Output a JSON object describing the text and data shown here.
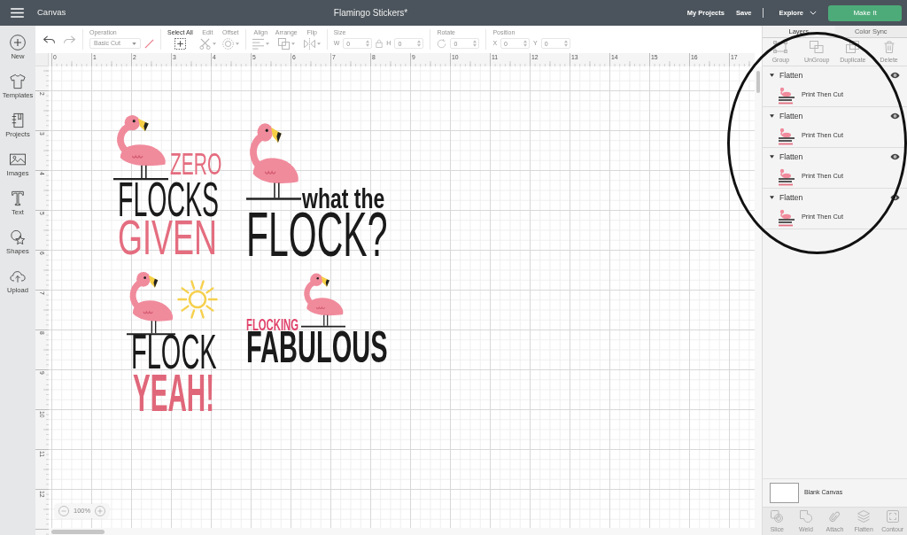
{
  "top_bar": {
    "app_title": "Canvas",
    "project_title": "Flamingo Stickers*",
    "links": [
      "My Projects",
      "Save"
    ],
    "explore": "Explore",
    "make_it": "Make It"
  },
  "sidebar": {
    "items": [
      {
        "label": "New"
      },
      {
        "label": "Templates"
      },
      {
        "label": "Projects"
      },
      {
        "label": "Images"
      },
      {
        "label": "Text"
      },
      {
        "label": "Shapes"
      },
      {
        "label": "Upload"
      }
    ]
  },
  "toolbar": {
    "groups": [
      [
        {
          "kind": "icon_button",
          "disabled": false
        },
        {
          "kind": "icon_button",
          "disabled": true
        }
      ],
      [
        {
          "kind": "dropdown",
          "label": "Operation",
          "value": "Basic Cut",
          "disabled": true
        }
      ],
      [
        {
          "kind": "tool",
          "label": "Select All",
          "disabled": false,
          "menu": false
        },
        {
          "kind": "tool",
          "label": "Edit",
          "disabled": true,
          "menu": true
        },
        {
          "kind": "tool",
          "label": "Offset",
          "disabled": true,
          "menu": true
        }
      ],
      [
        {
          "kind": "tool",
          "label": "Align",
          "disabled": true,
          "menu": true
        },
        {
          "kind": "tool",
          "label": "Arrange",
          "disabled": true,
          "menu": true
        },
        {
          "kind": "tool",
          "label": "Flip",
          "disabled": true,
          "menu": true
        }
      ],
      [
        {
          "kind": "size",
          "label": "Size",
          "disabled": true,
          "fields": [
            {
              "label": "W",
              "value": "0"
            },
            {
              "label": "H",
              "value": "0"
            }
          ]
        }
      ],
      [
        {
          "kind": "rotate",
          "label": "Rotate",
          "disabled": true,
          "fields": [
            {
              "value": "0"
            }
          ]
        }
      ],
      [
        {
          "kind": "position",
          "label": "Position",
          "disabled": true,
          "fields": [
            {
              "label": "X",
              "value": "0"
            },
            {
              "label": "Y",
              "value": "0"
            }
          ]
        }
      ]
    ]
  },
  "rulers": {
    "horizontal": [
      "0",
      "1",
      "2",
      "3",
      "4",
      "5",
      "6",
      "7",
      "8",
      "9",
      "10",
      "11",
      "12",
      "13",
      "14",
      "15",
      "16",
      "17"
    ],
    "vertical": [
      "2",
      "3",
      "4",
      "5",
      "6",
      "7",
      "8",
      "9",
      "10",
      "11",
      "12"
    ]
  },
  "canvas": {
    "designs": [
      {
        "lines": [
          {
            "text": "ZERO",
            "color": "#e46d7f"
          },
          {
            "text": "FLOCKS",
            "color": "#1a1a1a"
          },
          {
            "text": "GIVEN",
            "color": "#e46d7f"
          }
        ]
      },
      {
        "lines": [
          {
            "text": "what the",
            "color": "#1a1a1a"
          },
          {
            "text": "FLOCK?",
            "color": "#1a1a1a"
          }
        ]
      },
      {
        "lines": [
          {
            "text": "FLOCK",
            "color": "#1a1a1a"
          },
          {
            "text": "YEAH!",
            "color": "#e0677a"
          }
        ]
      },
      {
        "lines": [
          {
            "text": "FLOCKING",
            "color": "#e0436b"
          },
          {
            "text": "FABULOUS",
            "color": "#1a1a1a"
          }
        ]
      }
    ],
    "zoom": "100%"
  },
  "layers_panel": {
    "tabs": [
      {
        "label": "Layers",
        "selected": true
      },
      {
        "label": "Color Sync",
        "selected": false
      }
    ],
    "actions": [
      {
        "label": "Group",
        "disabled": true
      },
      {
        "label": "UnGroup",
        "disabled": true
      },
      {
        "label": "Duplicate",
        "disabled": true
      },
      {
        "label": "Delete",
        "disabled": true
      }
    ],
    "layers": [
      {
        "name": "Flatten",
        "expanded": true,
        "visible": true,
        "children": [
          {
            "name": "Print Then Cut"
          }
        ]
      },
      {
        "name": "Flatten",
        "expanded": true,
        "visible": true,
        "children": [
          {
            "name": "Print Then Cut"
          }
        ]
      },
      {
        "name": "Flatten",
        "expanded": true,
        "visible": true,
        "children": [
          {
            "name": "Print Then Cut"
          }
        ]
      },
      {
        "name": "Flatten",
        "expanded": true,
        "visible": true,
        "children": [
          {
            "name": "Print Then Cut"
          }
        ]
      }
    ],
    "canvas_row": "Blank Canvas",
    "bottom_actions": [
      {
        "label": "Slice",
        "disabled": true
      },
      {
        "label": "Weld",
        "disabled": true
      },
      {
        "label": "Attach",
        "disabled": true
      },
      {
        "label": "Flatten",
        "disabled": true
      },
      {
        "label": "Contour",
        "disabled": true
      }
    ]
  },
  "annotations": [
    {
      "kind": "ellipse"
    }
  ]
}
